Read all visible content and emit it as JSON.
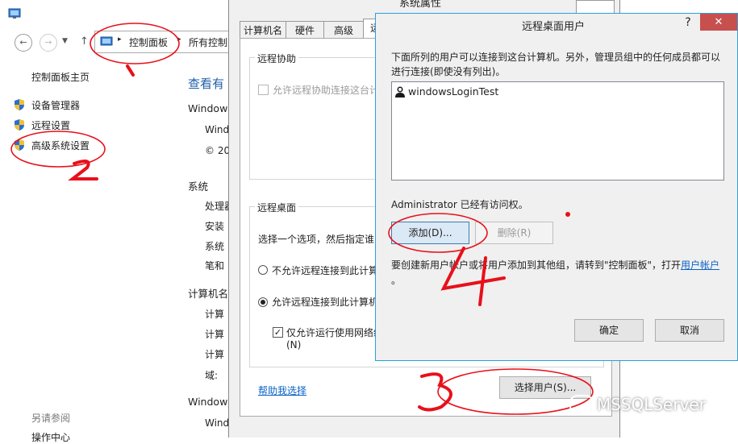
{
  "control_panel": {
    "breadcrumb": [
      "控制面板",
      "所有控制"
    ],
    "sidebar": {
      "home": "控制面板主页",
      "items": [
        {
          "label": "设备管理器",
          "icon": "shield-icon"
        },
        {
          "label": "远程设置",
          "icon": "shield-icon"
        },
        {
          "label": "高级系统设置",
          "icon": "shield-icon"
        }
      ],
      "see_also": "另请参阅",
      "action_center": "操作中心"
    },
    "main": {
      "view_title": "查看有",
      "windows_label": "Window",
      "win_line": "Wind",
      "copyright": "© 20",
      "system_label": "系统",
      "system_items": [
        "处理器",
        "安装",
        "系统",
        "笔和"
      ],
      "computer_label": "计算机名",
      "computer_items": [
        "计算",
        "计算",
        "计算",
        "域:"
      ],
      "windows_label2": "Window",
      "win_line2": "Wind"
    }
  },
  "system_properties": {
    "title": "系统属性",
    "tabs": [
      "计算机名",
      "硬件",
      "高级",
      "远"
    ],
    "remote_assist": {
      "title": "远程协助",
      "checkbox_label": "允许远程协助连接这台计"
    },
    "remote_desktop": {
      "title": "远程桌面",
      "prompt": "选择一个选项，然后指定谁",
      "option_deny": "不允许远程连接到此计算",
      "option_allow": "允许远程连接到此计算机",
      "nla_label": "仅允许运行使用网络级",
      "nla_suffix": "(N)",
      "help_link": "帮助我选择",
      "select_users_button": "选择用户(S)..."
    }
  },
  "remote_desktop_users": {
    "title": "远程桌面用户",
    "help_icon": "?",
    "close_icon": "✕",
    "description": "下面所列的用户可以连接到这台计算机。另外，管理员组中的任何成员都可以进行连接(即使没有列出)。",
    "users": [
      "windowsLoginTest"
    ],
    "access_note": "Administrator 已经有访问权。",
    "add_button": "添加(D)...",
    "remove_button": "删除(R)",
    "footer_text": "要创建新用户帐户或将用户添加到其他组，请转到\"控制面板\"，打开",
    "footer_link": "用户帐户",
    "footer_end": "。",
    "ok_button": "确定",
    "cancel_button": "取消"
  },
  "annotations": {
    "digits": [
      "1",
      "2",
      "3",
      "4"
    ],
    "color": "#e8101a"
  },
  "watermark": "MSSQLServer"
}
